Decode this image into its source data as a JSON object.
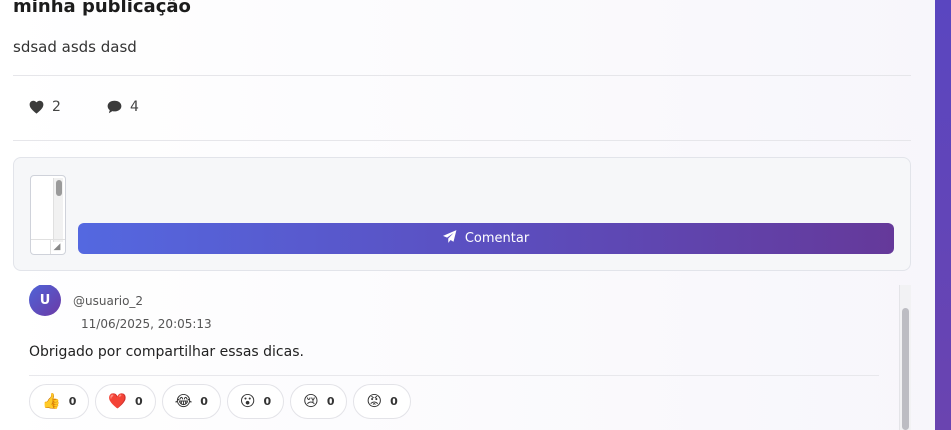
{
  "post": {
    "title": "minha publicação",
    "body": "sdsad asds dasd",
    "likes": "2",
    "comments": "4"
  },
  "icons": {
    "like": "heart-icon",
    "comment": "speech-bubble-icon",
    "send": "paper-plane-icon"
  },
  "comment_form": {
    "textarea_value": "",
    "submit_label": "Comentar"
  },
  "comments": [
    {
      "avatar_initial": "U",
      "username": "@usuario_2",
      "timestamp": "11/06/2025, 20:05:13",
      "text": "Obrigado por compartilhar essas dicas.",
      "reactions": [
        {
          "emoji": "👍",
          "name": "like",
          "count": "0"
        },
        {
          "emoji": "❤️",
          "name": "love",
          "count": "0"
        },
        {
          "emoji": "😂",
          "name": "laugh",
          "count": "0"
        },
        {
          "emoji": "😮",
          "name": "wow",
          "count": "0"
        },
        {
          "emoji": "😢",
          "name": "sad",
          "count": "0"
        },
        {
          "emoji": "😡",
          "name": "angry",
          "count": "0"
        }
      ]
    }
  ],
  "colors": {
    "accent_start": "#5468e0",
    "accent_end": "#65399a"
  }
}
